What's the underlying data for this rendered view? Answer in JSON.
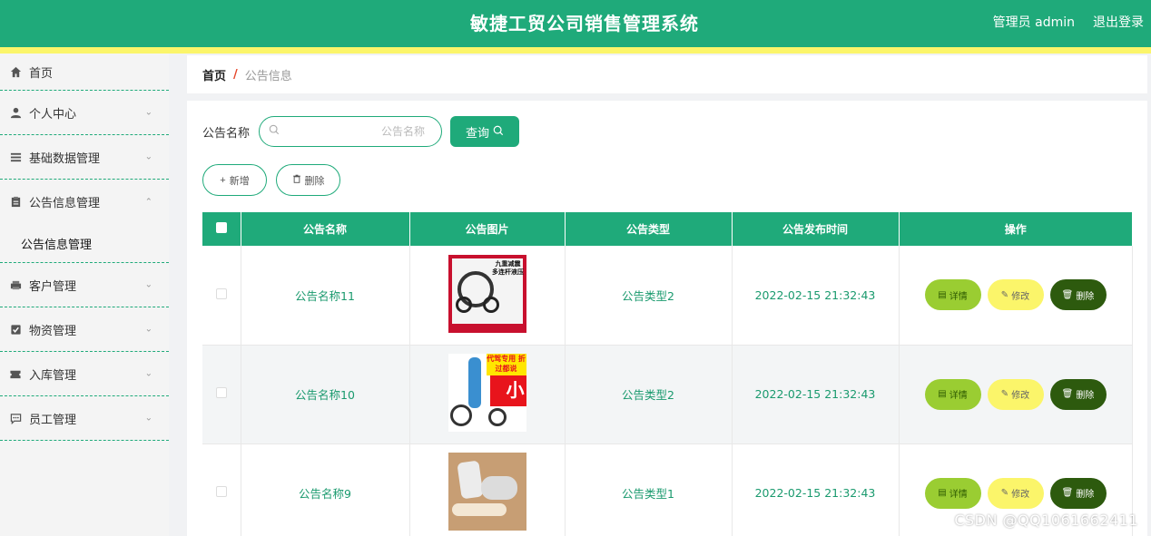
{
  "header": {
    "title": "敏捷工贸公司销售管理系统",
    "user_label": "管理员 admin",
    "logout_label": "退出登录"
  },
  "colors": {
    "primary": "#1faa7a",
    "stripe": "#fbf56a",
    "detail_btn": "#9acd32",
    "edit_btn": "#fbf56a",
    "delete_btn": "#2d5a0e",
    "breadcrumb_sep": "#e5462a"
  },
  "sidebar": {
    "items": [
      {
        "label": "首页",
        "icon": "home-icon"
      },
      {
        "label": "个人中心",
        "icon": "user-icon"
      },
      {
        "label": "基础数据管理",
        "icon": "list-icon"
      },
      {
        "label": "公告信息管理",
        "icon": "clipboard-icon"
      },
      {
        "label": "客户管理",
        "icon": "printer-icon"
      },
      {
        "label": "物资管理",
        "icon": "checkbox-icon"
      },
      {
        "label": "入库管理",
        "icon": "ticket-icon"
      },
      {
        "label": "员工管理",
        "icon": "chat-icon"
      }
    ],
    "submenu_label": "公告信息管理"
  },
  "breadcrumb": {
    "home": "首页",
    "separator": "/",
    "current": "公告信息"
  },
  "search": {
    "label": "公告名称",
    "placeholder": "公告名称",
    "button_label": "查询"
  },
  "actions": {
    "add_label": "新增",
    "delete_label": "删除"
  },
  "table": {
    "columns": [
      "公告名称",
      "公告图片",
      "公告类型",
      "公告发布时间",
      "操作"
    ],
    "rows": [
      {
        "name": "公告名称11",
        "type": "公告类型2",
        "time": "2022-02-15 21:32:43",
        "image_text": {
          "top": "九重减震 多连杆液压",
          "badge": "品牌特惠",
          "strip": "可折叠 锂电池",
          "bottom": "官方正品 售后无忧",
          "side": "顺丰包邮"
        }
      },
      {
        "name": "公告名称10",
        "type": "公告类型2",
        "time": "2022-02-15 21:32:43",
        "image_text": {
          "yellow": "代驾专用 折过都说",
          "red": "小"
        }
      },
      {
        "name": "公告名称9",
        "type": "公告类型1",
        "time": "2022-02-15 21:32:43"
      }
    ],
    "op_detail": "详情",
    "op_edit": "修改",
    "op_delete": "删除"
  },
  "watermark": "CSDN @QQ1061662411"
}
